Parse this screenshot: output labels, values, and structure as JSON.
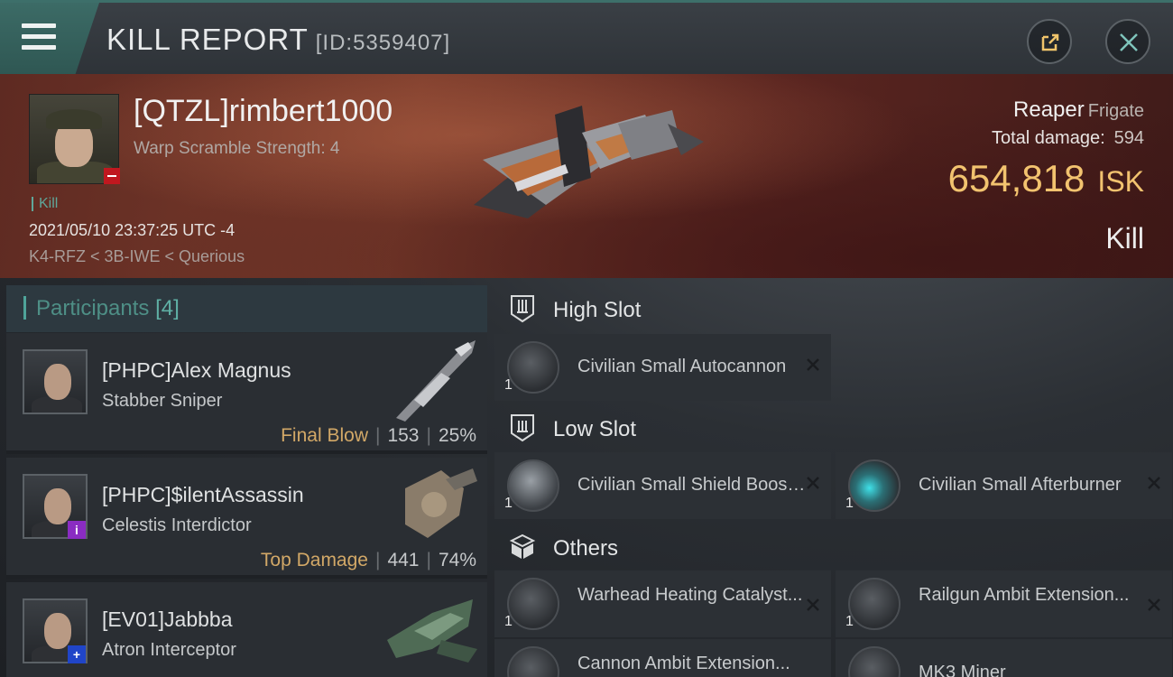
{
  "header": {
    "title": "KILL REPORT",
    "report_id": "[ID:5359407]",
    "icons": {
      "menu": "hamburger-menu-icon",
      "share": "share-external-icon",
      "close": "close-icon"
    }
  },
  "victim": {
    "name": "[QTZL]rimbert1000",
    "subtitle": "Warp Scramble Strength: 4",
    "event_tag": "Kill",
    "timestamp": "2021/05/10 23:37:25 UTC -4",
    "location": "K4-RFZ < 3B-IWE < Querious",
    "ship_name": "Reaper",
    "ship_class": "Frigate",
    "total_damage_label": "Total damage:",
    "total_damage": "594",
    "isk_value": "654,818",
    "isk_unit": "ISK",
    "result": "Kill"
  },
  "participants": {
    "label": "Participants",
    "count": "[4]",
    "rows": [
      {
        "name": "[PHPC]Alex Magnus",
        "ship": "Stabber Sniper",
        "tag": "Final Blow",
        "damage": "153",
        "percent": "25%"
      },
      {
        "name": "[PHPC]$ilentAssassin",
        "ship": "Celestis Interdictor",
        "tag": "Top Damage",
        "damage": "441",
        "percent": "74%",
        "badge": "i"
      },
      {
        "name": "[EV01]Jabbba",
        "ship": "Atron Interceptor",
        "badge": "+"
      }
    ]
  },
  "fitting": {
    "high_slot": {
      "label": "High Slot",
      "modules": [
        {
          "name": "Civilian Small Autocannon",
          "qty": "1"
        }
      ]
    },
    "low_slot": {
      "label": "Low Slot",
      "modules": [
        {
          "name": "Civilian Small Shield Booster",
          "qty": "1"
        },
        {
          "name": "Civilian Small Afterburner",
          "qty": "1"
        }
      ]
    },
    "others": {
      "label": "Others",
      "modules": [
        {
          "name": "Warhead Heating Catalyst...",
          "qty": "1"
        },
        {
          "name": "Railgun Ambit Extension...",
          "qty": "1"
        },
        {
          "name": "Cannon Ambit Extension...",
          "qty": ""
        },
        {
          "name": "MK3 Miner",
          "qty": ""
        }
      ]
    }
  },
  "colors": {
    "accent_teal": "#4fa49a",
    "isk_gold": "#f2c36f",
    "tag_gold": "#d2a867",
    "banner_red": "#7a3b2b"
  }
}
